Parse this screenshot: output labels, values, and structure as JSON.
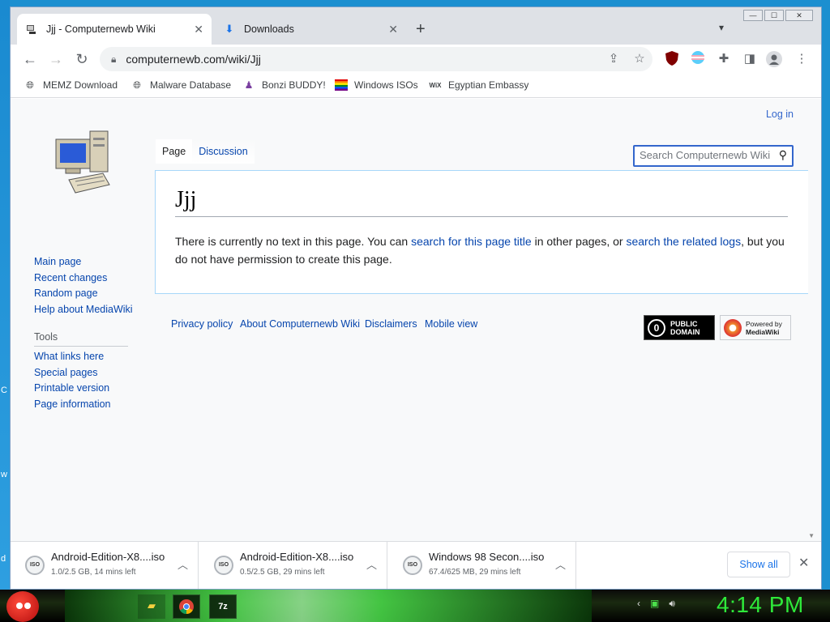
{
  "tabs": [
    {
      "title": "Jjj - Computernewb Wiki",
      "icon": "wiki-favicon-icon",
      "active": true
    },
    {
      "title": "Downloads",
      "icon": "download-icon",
      "active": false
    }
  ],
  "window_controls": {
    "minimize": "—",
    "maximize": "☐",
    "close": "✕"
  },
  "toolbar": {
    "url": "computernewb.com/wiki/Jjj"
  },
  "bookmarks": [
    {
      "label": "MEMZ Download",
      "icon": "globe-icon"
    },
    {
      "label": "Malware Database",
      "icon": "globe-icon"
    },
    {
      "label": "Bonzi BUDDY!",
      "icon": "bonzi-icon"
    },
    {
      "label": "Windows ISOs",
      "icon": "rainbow-flag-icon"
    },
    {
      "label": "Egyptian Embassy",
      "icon": "wix-icon"
    }
  ],
  "wiki": {
    "login": "Log in",
    "nav": [
      "Main page",
      "Recent changes",
      "Random page",
      "Help about MediaWiki"
    ],
    "tools_heading": "Tools",
    "tools": [
      "What links here",
      "Special pages",
      "Printable version",
      "Page information"
    ],
    "tab_page": "Page",
    "tab_discussion": "Discussion",
    "search_placeholder": "Search Computernewb Wiki",
    "title": "Jjj",
    "body_pre": "There is currently no text in this page. You can ",
    "body_link1": "search for this page title",
    "body_mid": " in other pages, or ",
    "body_link2": "search the related logs",
    "body_post": ", but you do not have permission to create this page.",
    "footer_links": [
      "Privacy policy",
      "About Computernewb Wiki",
      "Disclaimers",
      "Mobile view"
    ],
    "pd_badge": {
      "line1": "PUBLIC",
      "line2": "DOMAIN"
    },
    "mw_badge": {
      "line1": "Powered by",
      "line2": "MediaWiki"
    }
  },
  "downloads": [
    {
      "name": "Android-Edition-X8....iso",
      "status": "1.0/2.5 GB, 14 mins left"
    },
    {
      "name": "Android-Edition-X8....iso",
      "status": "0.5/2.5 GB, 29 mins left"
    },
    {
      "name": "Windows 98 Secon....iso",
      "status": "67.4/625 MB, 29 mins left"
    }
  ],
  "download_bar": {
    "show_all": "Show all",
    "close": "✕"
  },
  "taskbar": {
    "clock": "4:14 PM"
  },
  "colors": {
    "link": "#0645ad",
    "clock": "#2eea3a",
    "accent": "#1a73e8"
  }
}
